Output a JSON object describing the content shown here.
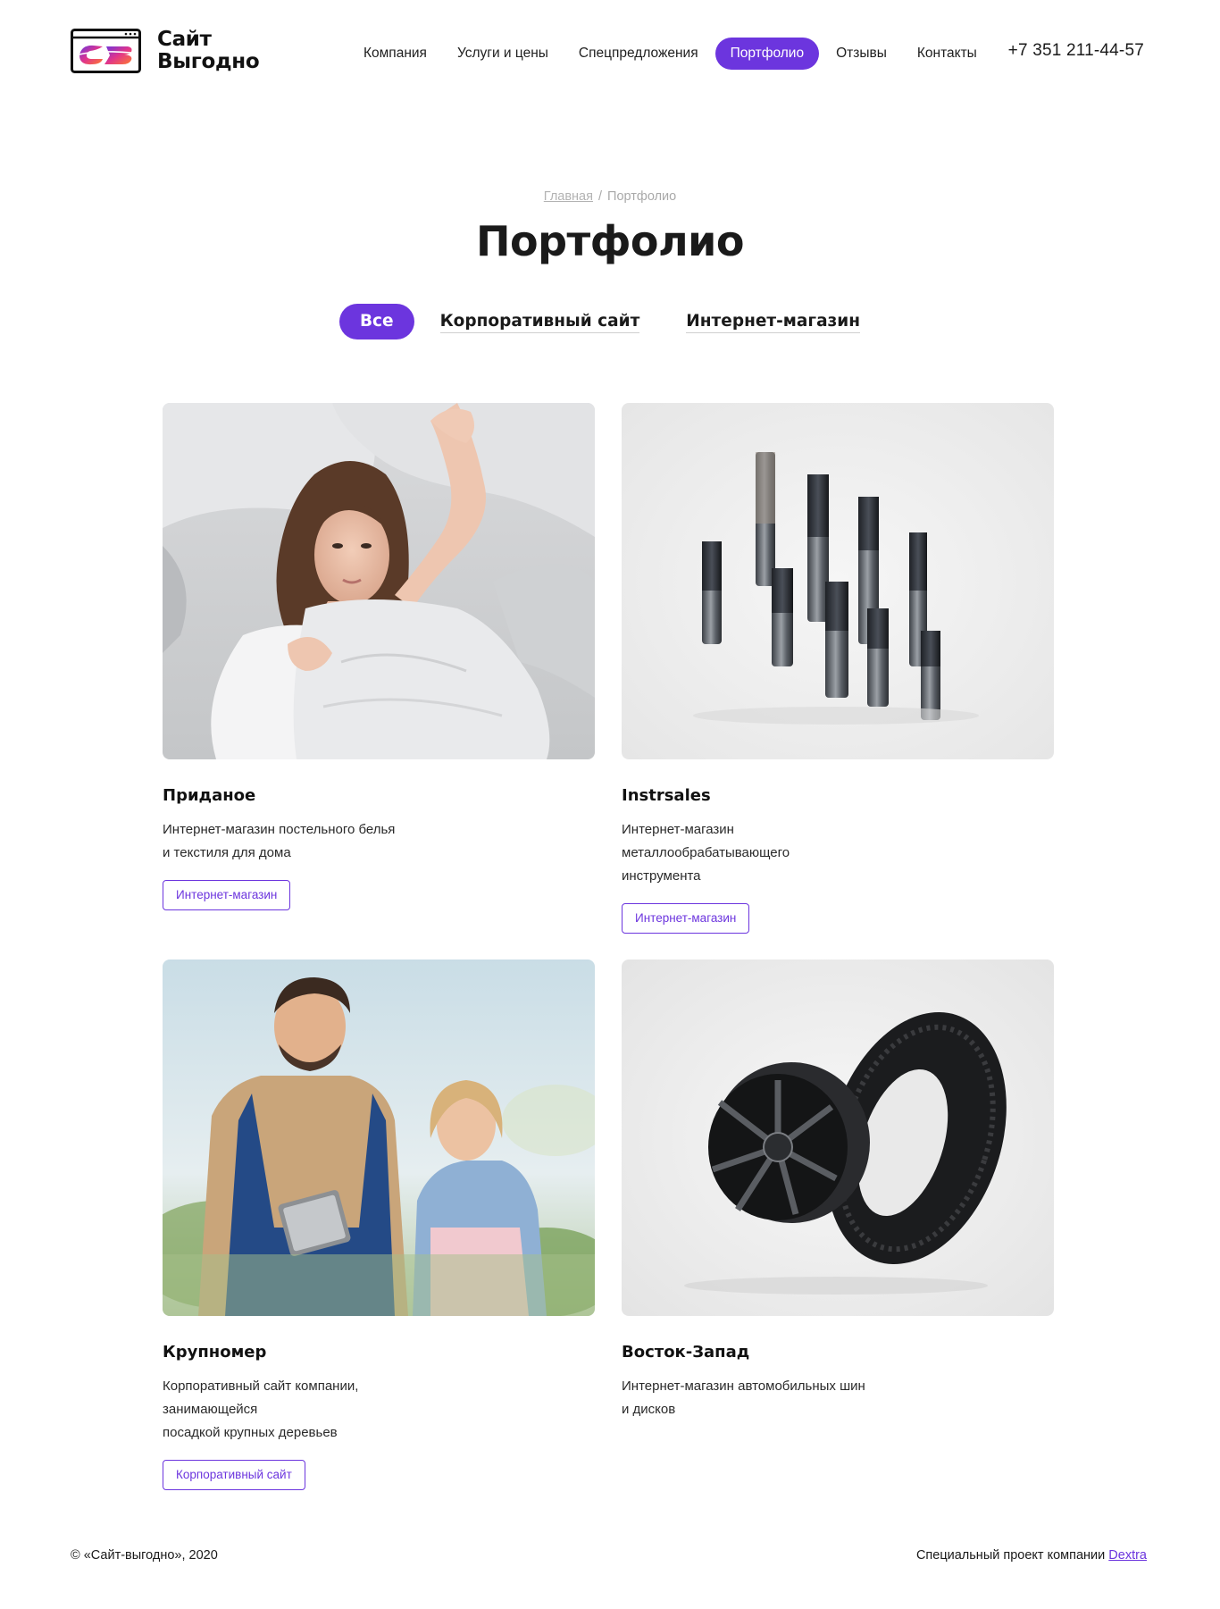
{
  "header": {
    "logo_line1": "Сайт",
    "logo_line2": "Выгодно",
    "nav": [
      {
        "label": "Компания",
        "active": false
      },
      {
        "label": "Услуги и цены",
        "active": false
      },
      {
        "label": "Спецпредложения",
        "active": false
      },
      {
        "label": "Портфолио",
        "active": true
      },
      {
        "label": "Отзывы",
        "active": false
      },
      {
        "label": "Контакты",
        "active": false
      }
    ],
    "phone": "+7 351 211-44-57"
  },
  "breadcrumb": {
    "home": "Главная",
    "separator": "/",
    "current": "Портфолио"
  },
  "page_title": "Портфолио",
  "filters": [
    {
      "label": "Все",
      "active": true
    },
    {
      "label": "Корпоративный сайт",
      "active": false
    },
    {
      "label": "Интернет-магазин",
      "active": false
    }
  ],
  "cards": [
    {
      "title": "Приданое",
      "desc_line1": "Интернет-магазин постельного белья",
      "desc_line2": "и текстиля для дома",
      "tag": "Интернет-магазин",
      "image": "woman-in-bed-photo"
    },
    {
      "title": "Instrsales",
      "desc_line1": "Интернет-магазин металлообрабатывающего",
      "desc_line2": "инструмента",
      "tag": "Интернет-магазин",
      "image": "end-mills-photo"
    },
    {
      "title": "Крупномер",
      "desc_line1": "Корпоративный сайт компании, занимающейся",
      "desc_line2": "посадкой крупных деревьев",
      "tag": "Корпоративный сайт",
      "image": "gardeners-with-tablet-photo"
    },
    {
      "title": "Восток-Запад",
      "desc_line1": "Интернет-магазин автомобильных шин",
      "desc_line2": "и дисков",
      "tag": "",
      "image": "tire-and-wheel-photo"
    }
  ],
  "footer": {
    "copyright": "© «Сайт-выгодно», 2020",
    "project_text": "Специальный проект компании",
    "project_link": "Dextra"
  },
  "colors": {
    "accent": "#6c35de",
    "text": "#1a1a1a",
    "muted": "#a9a9a9"
  }
}
